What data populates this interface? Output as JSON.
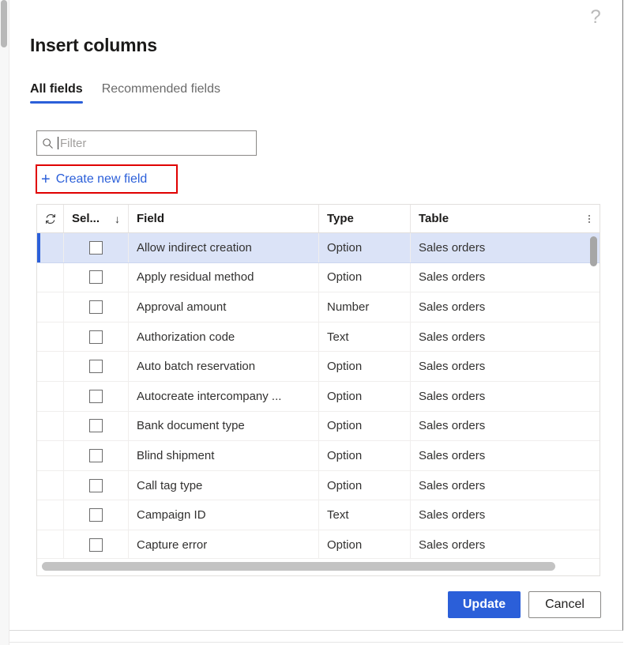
{
  "dialog": {
    "title": "Insert columns",
    "help_icon": "help-question-icon"
  },
  "tabs": [
    {
      "label": "All fields",
      "active": true
    },
    {
      "label": "Recommended fields",
      "active": false
    }
  ],
  "filter": {
    "placeholder": "Filter",
    "value": "",
    "icon": "search-icon"
  },
  "create_new_field": {
    "label": "Create new field",
    "icon": "plus-icon",
    "annotation_color": "#e00000"
  },
  "grid": {
    "columns": {
      "refresh_icon": "refresh-icon",
      "select": "Sel...",
      "sort_indicator": "↓",
      "field": "Field",
      "type": "Type",
      "table": "Table",
      "options_icon": "more-options-icon"
    },
    "rows": [
      {
        "field": "Allow indirect creation",
        "type": "Option",
        "table": "Sales orders",
        "checked": false,
        "selected": true
      },
      {
        "field": "Apply residual method",
        "type": "Option",
        "table": "Sales orders",
        "checked": false,
        "selected": false
      },
      {
        "field": "Approval amount",
        "type": "Number",
        "table": "Sales orders",
        "checked": false,
        "selected": false
      },
      {
        "field": "Authorization code",
        "type": "Text",
        "table": "Sales orders",
        "checked": false,
        "selected": false
      },
      {
        "field": "Auto batch reservation",
        "type": "Option",
        "table": "Sales orders",
        "checked": false,
        "selected": false
      },
      {
        "field": "Autocreate intercompany ...",
        "type": "Option",
        "table": "Sales orders",
        "checked": false,
        "selected": false
      },
      {
        "field": "Bank document type",
        "type": "Option",
        "table": "Sales orders",
        "checked": false,
        "selected": false
      },
      {
        "field": "Blind shipment",
        "type": "Option",
        "table": "Sales orders",
        "checked": false,
        "selected": false
      },
      {
        "field": "Call tag type",
        "type": "Option",
        "table": "Sales orders",
        "checked": false,
        "selected": false
      },
      {
        "field": "Campaign ID",
        "type": "Text",
        "table": "Sales orders",
        "checked": false,
        "selected": false
      },
      {
        "field": "Capture error",
        "type": "Option",
        "table": "Sales orders",
        "checked": false,
        "selected": false
      }
    ]
  },
  "footer": {
    "update_label": "Update",
    "cancel_label": "Cancel"
  },
  "colors": {
    "accent": "#2b5fd9",
    "selected_row": "#dbe3f7",
    "annotation": "#e00000"
  }
}
